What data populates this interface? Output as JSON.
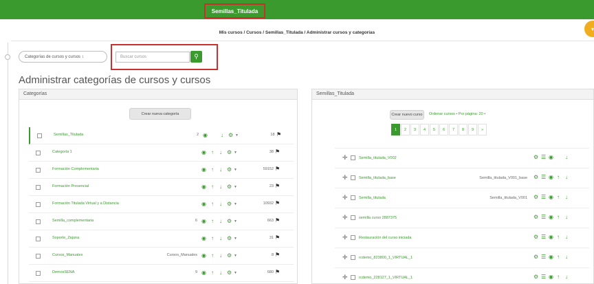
{
  "header": {
    "site_title": "Semillas_Titulada",
    "breadcrumb": "Mis cursos / Cursos / Semillas_Titulada / Administrar cursos y categorías"
  },
  "toolbar": {
    "category_select": "Categorías de cursos y cursos ↕",
    "search_placeholder": "Buscar cursos",
    "search_icon": "search-icon"
  },
  "page_title": "Administrar categorías de cursos y cursos",
  "categories_panel": {
    "title": "Categorías",
    "create_button": "Crear nueva categoría",
    "items": [
      {
        "name": "Semillas_Titulada",
        "idnumber": "2",
        "count": "18 ",
        "up": false
      },
      {
        "name": "Categoría 1",
        "idnumber": "",
        "count": "38",
        "up": true
      },
      {
        "name": "Formación Complementaria",
        "idnumber": "",
        "count": "59152",
        "up": true
      },
      {
        "name": "Formación Presencial",
        "idnumber": "",
        "count": "23",
        "up": true
      },
      {
        "name": "Formación Titulada Virtual y a Distancia",
        "idnumber": "",
        "count": "10932",
        "up": true
      },
      {
        "name": "Semilla_complementaria",
        "idnumber": "6",
        "count": "663",
        "up": true
      },
      {
        "name": "Soporte_Zajuna",
        "idnumber": "",
        "count": "31",
        "up": true
      },
      {
        "name": "Cursos_Manuales",
        "idnumber": "Cursos_Manuales",
        "count": "8",
        "up": true
      },
      {
        "name": "DemosSENA",
        "idnumber": "9",
        "count": "680",
        "up": true
      }
    ]
  },
  "courses_panel": {
    "title": "Semillas_Titulada",
    "create_button": "Crear nuevo curso",
    "options": "Ordenar cursos • Por página: 20 •",
    "pages": [
      "1",
      "2",
      "3",
      "4",
      "5",
      "6",
      "7",
      "8",
      "9",
      "»"
    ],
    "active_page": "1",
    "courses": [
      {
        "name": "Semilla_titulada_V002",
        "shortname": ""
      },
      {
        "name": "Semilla_titulada_base",
        "shortname": "Semilla_titulada_V001_base"
      },
      {
        "name": "Semilla_titulada",
        "shortname": "Semilla_titulada_V001"
      },
      {
        "name": "semilla curso 2887375",
        "shortname": ""
      },
      {
        "name": "Restauración del curso iniciada",
        "shortname": ""
      },
      {
        "name": "rcdemo_823800_1_VIRTUAL_1",
        "shortname": ""
      },
      {
        "name": "rcdemo_228127_1_VIRTUAL_1",
        "shortname": ""
      }
    ]
  },
  "colors": {
    "brand": "#3a9a2e",
    "highlight_border": "#c9302c",
    "avatar": "#f0ad1f"
  }
}
